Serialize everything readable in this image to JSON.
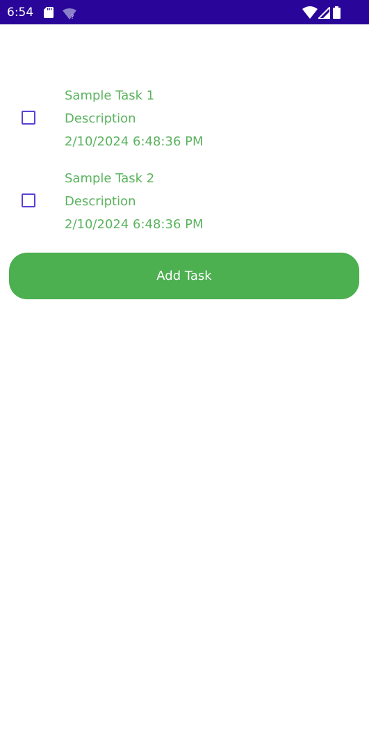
{
  "status_bar": {
    "time": "6:54",
    "background_color": "#2a0599",
    "icons": [
      "sd-card-icon",
      "wifi-unknown-icon",
      "wifi-icon",
      "signal-icon",
      "battery-icon"
    ]
  },
  "tasks": [
    {
      "title": "Sample Task 1",
      "description": "Description",
      "datetime": "2/10/2024 6:48:36 PM",
      "checked": false
    },
    {
      "title": "Sample Task 2",
      "description": "Description",
      "datetime": "2/10/2024 6:48:36 PM",
      "checked": false
    }
  ],
  "add_button": {
    "label": "Add Task",
    "color": "#4caf50"
  },
  "colors": {
    "text_accent": "#5bb35e",
    "checkbox_border": "#5c3fd6"
  }
}
